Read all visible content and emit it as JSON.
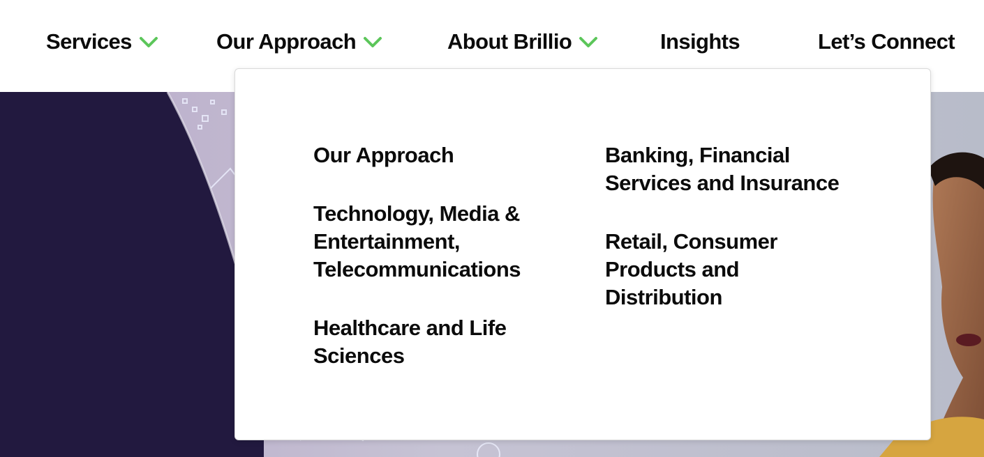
{
  "nav": {
    "items": [
      {
        "label": "Services",
        "has_dropdown": true
      },
      {
        "label": "Our Approach",
        "has_dropdown": true
      },
      {
        "label": "About Brillio",
        "has_dropdown": true
      },
      {
        "label": "Insights",
        "has_dropdown": false
      },
      {
        "label": "Let’s Connect",
        "has_dropdown": false
      }
    ],
    "chevron_icon": "chevron-down-icon",
    "chevron_color": "#5cc65a"
  },
  "dropdown": {
    "left_column": [
      {
        "label": "Our Approach"
      },
      {
        "label": "Technology, Media & Entertainment, Telecommunications"
      },
      {
        "label": "Healthcare and Life Sciences"
      }
    ],
    "right_column": [
      {
        "label": "Banking, Financial Services and Insurance"
      },
      {
        "label": "Retail, Consumer Products and Distribution"
      }
    ]
  },
  "colors": {
    "text": "#0b0b0b",
    "hero_navy": "#22193f",
    "accent_green": "#5cc65a"
  }
}
